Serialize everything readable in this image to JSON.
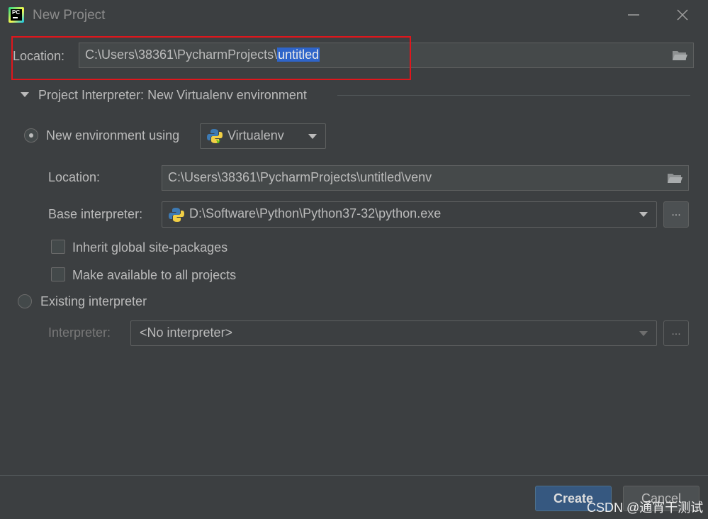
{
  "window": {
    "title": "New Project",
    "app_icon_text": "PC"
  },
  "project": {
    "location_label": "Location:",
    "location_path_prefix": "C:\\Users\\38361\\PycharmProjects\\",
    "location_path_selected": "untitled"
  },
  "interpreter_section": {
    "title": "Project Interpreter: New Virtualenv environment",
    "expanded": true
  },
  "new_env": {
    "radio_label": "New environment using",
    "selected": true,
    "tool_value": "Virtualenv",
    "location_label": "Location:",
    "location_value": "C:\\Users\\38361\\PycharmProjects\\untitled\\venv",
    "base_interpreter_label": "Base interpreter:",
    "base_interpreter_value": "D:\\Software\\Python\\Python37-32\\python.exe",
    "browse_label": "...",
    "inherit_label": "Inherit global site-packages",
    "inherit_checked": false,
    "make_available_label": "Make available to all projects",
    "make_available_checked": false
  },
  "existing": {
    "radio_label": "Existing interpreter",
    "selected": false,
    "interpreter_label": "Interpreter:",
    "interpreter_value": "<No interpreter>",
    "browse_label": "..."
  },
  "footer": {
    "create_label": "Create",
    "cancel_label": "Cancel"
  },
  "watermark": "CSDN @通宵干测试",
  "colors": {
    "background": "#3c3f41",
    "field": "#45494a",
    "selection": "#2f65ca",
    "create_button": "#365880",
    "highlight_box": "#e0161c"
  }
}
